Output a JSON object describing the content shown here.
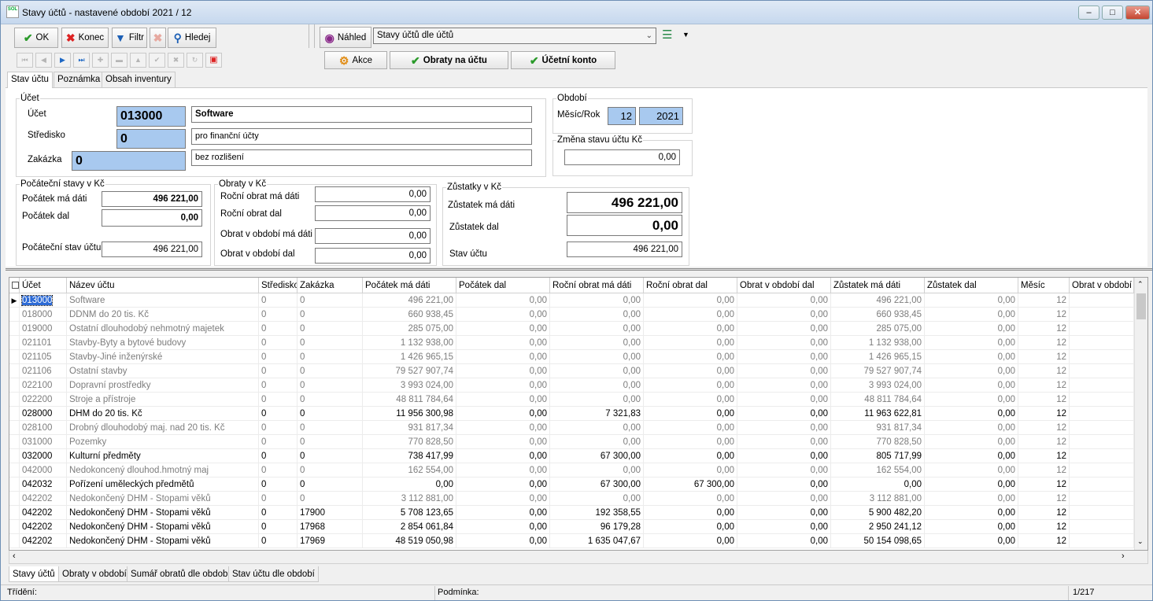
{
  "window": {
    "title": "Stavy účtů - nastavené období 2021 / 12",
    "app_icon": "SOL"
  },
  "toolbar": {
    "ok": "OK",
    "konec": "Konec",
    "filtr": "Filtr",
    "hledej": "Hledej",
    "nahled": "Náhled",
    "view_select": "Stavy účtů dle účtů",
    "akce": "Akce",
    "obraty": "Obraty na účtu",
    "ucetni_konto": "Účetní konto"
  },
  "tabs": [
    "Stav účtu",
    "Poznámka",
    "Obsah inventury"
  ],
  "form": {
    "ucet_legend": "Účet",
    "ucet_label": "Účet",
    "ucet_value": "013000",
    "ucet_name": "Software",
    "stredisko_label": "Středisko",
    "stredisko_value": "0",
    "stredisko_name": "pro finanční účty",
    "zakazka_label": "Zakázka",
    "zakazka_value": "0",
    "zakazka_name": "bez rozlišení",
    "obdobi_legend": "Období",
    "mesic_rok_label": "Měsíc/Rok",
    "mesic": "12",
    "rok": "2021",
    "zmena_legend": "Změna stavu účtu Kč",
    "zmena_value": "0,00",
    "pocatecni_legend": "Počáteční stavy v Kč",
    "pocatek_md_label": "Počátek má dáti",
    "pocatek_md": "496 221,00",
    "pocatek_dal_label": "Počátek dal",
    "pocatek_dal": "0,00",
    "pocatecni_stav_label": "Počáteční stav účtu",
    "pocatecni_stav": "496 221,00",
    "obraty_legend": "Obraty v Kč",
    "rocni_md_label": "Roční obrat má dáti",
    "rocni_md": "0,00",
    "rocni_dal_label": "Roční obrat dal",
    "rocni_dal": "0,00",
    "obd_md_label": "Obrat v období má dáti",
    "obd_md": "0,00",
    "obd_dal_label": "Obrat v období dal",
    "obd_dal": "0,00",
    "zustatky_legend": "Zůstatky v Kč",
    "zust_md_label": "Zůstatek má dáti",
    "zust_md": "496 221,00",
    "zust_dal_label": "Zůstatek dal",
    "zust_dal": "0,00",
    "stav_label": "Stav účtu",
    "stav": "496 221,00"
  },
  "grid": {
    "columns": [
      "Účet",
      "Název účtu",
      "Středisko",
      "Zakázka",
      "Počátek má dáti",
      "Počátek dal",
      "Roční obrat má dáti",
      "Roční obrat dal",
      "Obrat v období dal",
      "Zůstatek má dáti",
      "Zůstatek dal",
      "Měsíc",
      "Obrat v období má"
    ],
    "rows": [
      {
        "ucet": "013000",
        "nazev": "Software",
        "str": "0",
        "zak": "0",
        "pmd": "496 221,00",
        "pdal": "0,00",
        "rmd": "0,00",
        "rdal": "0,00",
        "odal": "0,00",
        "zmd": "496 221,00",
        "zdal": "0,00",
        "mes": "12",
        "style": "gray",
        "selected": true
      },
      {
        "ucet": "018000",
        "nazev": "DDNM do 20 tis. Kč",
        "str": "0",
        "zak": "0",
        "pmd": "660 938,45",
        "pdal": "0,00",
        "rmd": "0,00",
        "rdal": "0,00",
        "odal": "0,00",
        "zmd": "660 938,45",
        "zdal": "0,00",
        "mes": "12",
        "style": "gray"
      },
      {
        "ucet": "019000",
        "nazev": "Ostatní dlouhodobý nehmotný majetek",
        "str": "0",
        "zak": "0",
        "pmd": "285 075,00",
        "pdal": "0,00",
        "rmd": "0,00",
        "rdal": "0,00",
        "odal": "0,00",
        "zmd": "285 075,00",
        "zdal": "0,00",
        "mes": "12",
        "style": "gray"
      },
      {
        "ucet": "021101",
        "nazev": "Stavby-Byty a bytové budovy",
        "str": "0",
        "zak": "0",
        "pmd": "1 132 938,00",
        "pdal": "0,00",
        "rmd": "0,00",
        "rdal": "0,00",
        "odal": "0,00",
        "zmd": "1 132 938,00",
        "zdal": "0,00",
        "mes": "12",
        "style": "gray"
      },
      {
        "ucet": "021105",
        "nazev": "Stavby-Jiné inženýrské",
        "str": "0",
        "zak": "0",
        "pmd": "1 426 965,15",
        "pdal": "0,00",
        "rmd": "0,00",
        "rdal": "0,00",
        "odal": "0,00",
        "zmd": "1 426 965,15",
        "zdal": "0,00",
        "mes": "12",
        "style": "gray"
      },
      {
        "ucet": "021106",
        "nazev": "Ostatní stavby",
        "str": "0",
        "zak": "0",
        "pmd": "79 527 907,74",
        "pdal": "0,00",
        "rmd": "0,00",
        "rdal": "0,00",
        "odal": "0,00",
        "zmd": "79 527 907,74",
        "zdal": "0,00",
        "mes": "12",
        "style": "gray"
      },
      {
        "ucet": "022100",
        "nazev": "Dopravní prostředky",
        "str": "0",
        "zak": "0",
        "pmd": "3 993 024,00",
        "pdal": "0,00",
        "rmd": "0,00",
        "rdal": "0,00",
        "odal": "0,00",
        "zmd": "3 993 024,00",
        "zdal": "0,00",
        "mes": "12",
        "style": "gray"
      },
      {
        "ucet": "022200",
        "nazev": "Stroje a přístroje",
        "str": "0",
        "zak": "0",
        "pmd": "48 811 784,64",
        "pdal": "0,00",
        "rmd": "0,00",
        "rdal": "0,00",
        "odal": "0,00",
        "zmd": "48 811 784,64",
        "zdal": "0,00",
        "mes": "12",
        "style": "gray"
      },
      {
        "ucet": "028000",
        "nazev": "DHM do 20 tis. Kč",
        "str": "0",
        "zak": "0",
        "pmd": "11 956 300,98",
        "pdal": "0,00",
        "rmd": "7 321,83",
        "rdal": "0,00",
        "odal": "0,00",
        "zmd": "11 963 622,81",
        "zdal": "0,00",
        "mes": "12",
        "style": "black"
      },
      {
        "ucet": "028100",
        "nazev": "Drobný dlouhodobý maj. nad 20 tis. Kč",
        "str": "0",
        "zak": "0",
        "pmd": "931 817,34",
        "pdal": "0,00",
        "rmd": "0,00",
        "rdal": "0,00",
        "odal": "0,00",
        "zmd": "931 817,34",
        "zdal": "0,00",
        "mes": "12",
        "style": "gray"
      },
      {
        "ucet": "031000",
        "nazev": "Pozemky",
        "str": "0",
        "zak": "0",
        "pmd": "770 828,50",
        "pdal": "0,00",
        "rmd": "0,00",
        "rdal": "0,00",
        "odal": "0,00",
        "zmd": "770 828,50",
        "zdal": "0,00",
        "mes": "12",
        "style": "gray"
      },
      {
        "ucet": "032000",
        "nazev": "Kulturní předměty",
        "str": "0",
        "zak": "0",
        "pmd": "738 417,99",
        "pdal": "0,00",
        "rmd": "67 300,00",
        "rdal": "0,00",
        "odal": "0,00",
        "zmd": "805 717,99",
        "zdal": "0,00",
        "mes": "12",
        "style": "black"
      },
      {
        "ucet": "042000",
        "nazev": "Nedokoncený dlouhod.hmotný maj",
        "str": "0",
        "zak": "0",
        "pmd": "162 554,00",
        "pdal": "0,00",
        "rmd": "0,00",
        "rdal": "0,00",
        "odal": "0,00",
        "zmd": "162 554,00",
        "zdal": "0,00",
        "mes": "12",
        "style": "gray"
      },
      {
        "ucet": "042032",
        "nazev": "Pořízení uměleckých předmětů",
        "str": "0",
        "zak": "0",
        "pmd": "0,00",
        "pdal": "0,00",
        "rmd": "67 300,00",
        "rdal": "67 300,00",
        "odal": "0,00",
        "zmd": "0,00",
        "zdal": "0,00",
        "mes": "12",
        "style": "black"
      },
      {
        "ucet": "042202",
        "nazev": "Nedokončený DHM  - Stopami věků",
        "str": "0",
        "zak": "0",
        "pmd": "3 112 881,00",
        "pdal": "0,00",
        "rmd": "0,00",
        "rdal": "0,00",
        "odal": "0,00",
        "zmd": "3 112 881,00",
        "zdal": "0,00",
        "mes": "12",
        "style": "gray"
      },
      {
        "ucet": "042202",
        "nazev": "Nedokončený DHM  - Stopami věků",
        "str": "0",
        "zak": "17900",
        "pmd": "5 708 123,65",
        "pdal": "0,00",
        "rmd": "192 358,55",
        "rdal": "0,00",
        "odal": "0,00",
        "zmd": "5 900 482,20",
        "zdal": "0,00",
        "mes": "12",
        "style": "black"
      },
      {
        "ucet": "042202",
        "nazev": "Nedokončený DHM  - Stopami věků",
        "str": "0",
        "zak": "17968",
        "pmd": "2 854 061,84",
        "pdal": "0,00",
        "rmd": "96 179,28",
        "rdal": "0,00",
        "odal": "0,00",
        "zmd": "2 950 241,12",
        "zdal": "0,00",
        "mes": "12",
        "style": "black"
      },
      {
        "ucet": "042202",
        "nazev": "Nedokončený DHM  - Stopami věků",
        "str": "0",
        "zak": "17969",
        "pmd": "48 519 050,98",
        "pdal": "0,00",
        "rmd": "1 635 047,67",
        "rdal": "0,00",
        "odal": "0,00",
        "zmd": "50 154 098,65",
        "zdal": "0,00",
        "mes": "12",
        "style": "black"
      }
    ]
  },
  "bottom_tabs": [
    "Stavy účtů",
    "Obraty v období",
    "Sumář obratů dle období",
    "Stav účtu dle období"
  ],
  "status": {
    "trideni": "Třídění:",
    "podminka": "Podmínka:",
    "record": "1/217"
  },
  "colors": {
    "input_blue": "#a8c9ef",
    "selection": "#2d6bd6",
    "gray_text": "#7d7d7d"
  }
}
